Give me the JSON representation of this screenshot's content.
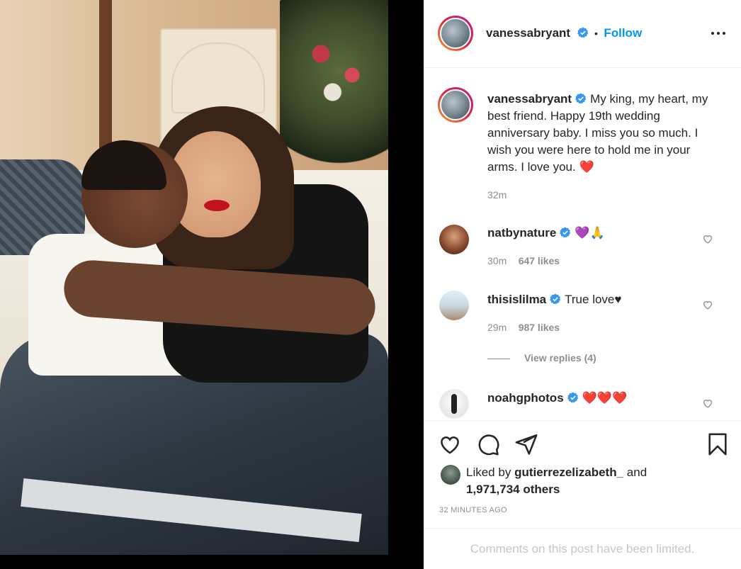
{
  "post": {
    "image_alt": "Couple embracing on a white couch"
  },
  "header": {
    "username": "vanessabryant",
    "separator": "•",
    "follow_label": "Follow",
    "more_icon": "more-options-icon"
  },
  "caption": {
    "username": "vanessabryant",
    "text": "My king, my heart, my best friend. Happy 19th wedding anniversary baby. I miss you so much. I wish you were here to hold me in your arms. I love you.",
    "emoji": "❤️",
    "time": "32m"
  },
  "comments": [
    {
      "username": "natbynature",
      "text": "💜🙏",
      "time": "30m",
      "likes": "647 likes"
    },
    {
      "username": "thisislilma",
      "text": "True love♥",
      "time": "29m",
      "likes": "987 likes"
    },
    {
      "username": "noahgphotos",
      "text": "❤️❤️❤️"
    }
  ],
  "view_replies": "View replies (4)",
  "actions": {
    "like_icon": "heart-icon",
    "comment_icon": "comment-icon",
    "share_icon": "share-icon",
    "save_icon": "bookmark-icon"
  },
  "liked_by": {
    "prefix": "Liked by",
    "user": "gutierrezelizabeth_",
    "and": "and",
    "count": "1,971,734 others"
  },
  "timestamp": "32 MINUTES AGO",
  "comments_limited": "Comments on this post have been limited.",
  "colors": {
    "follow": "#0095f6",
    "verified": "#3897f0",
    "heart": "#ed4956",
    "muted": "#8e8e8e"
  }
}
